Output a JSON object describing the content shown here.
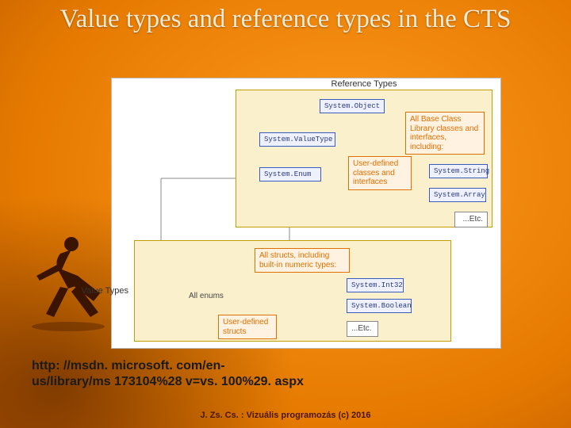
{
  "title": "Value types and reference types in the CTS",
  "url_line1": "http: //msdn. microsoft. com/en-",
  "url_line2": "us/library/ms 173104%28 v=vs. 100%29. aspx",
  "footer": "J. Zs. Cs. : Vizuális programozás (c) 2016",
  "diagram": {
    "refGroupLabel": "Reference Types",
    "valGroupLabel": "Value Types",
    "nodes": {
      "systemObject": "System.Object",
      "systemValueType": "System.ValueType",
      "systemEnum": "System.Enum",
      "baseLib": "All Base Class Library classes and interfaces, including:",
      "userClasses": "User-defined classes and interfaces",
      "systemString": "System.String",
      "systemArray": "System.Array",
      "etcRef": "...Etc.",
      "allEnums": "All enums",
      "allStructs": "All structs, including built-in numeric types:",
      "systemInt32": "System.Int32",
      "systemBoolean": "System.Boolean",
      "userStructs": "User-defined structs",
      "etcVal": "...Etc."
    }
  }
}
